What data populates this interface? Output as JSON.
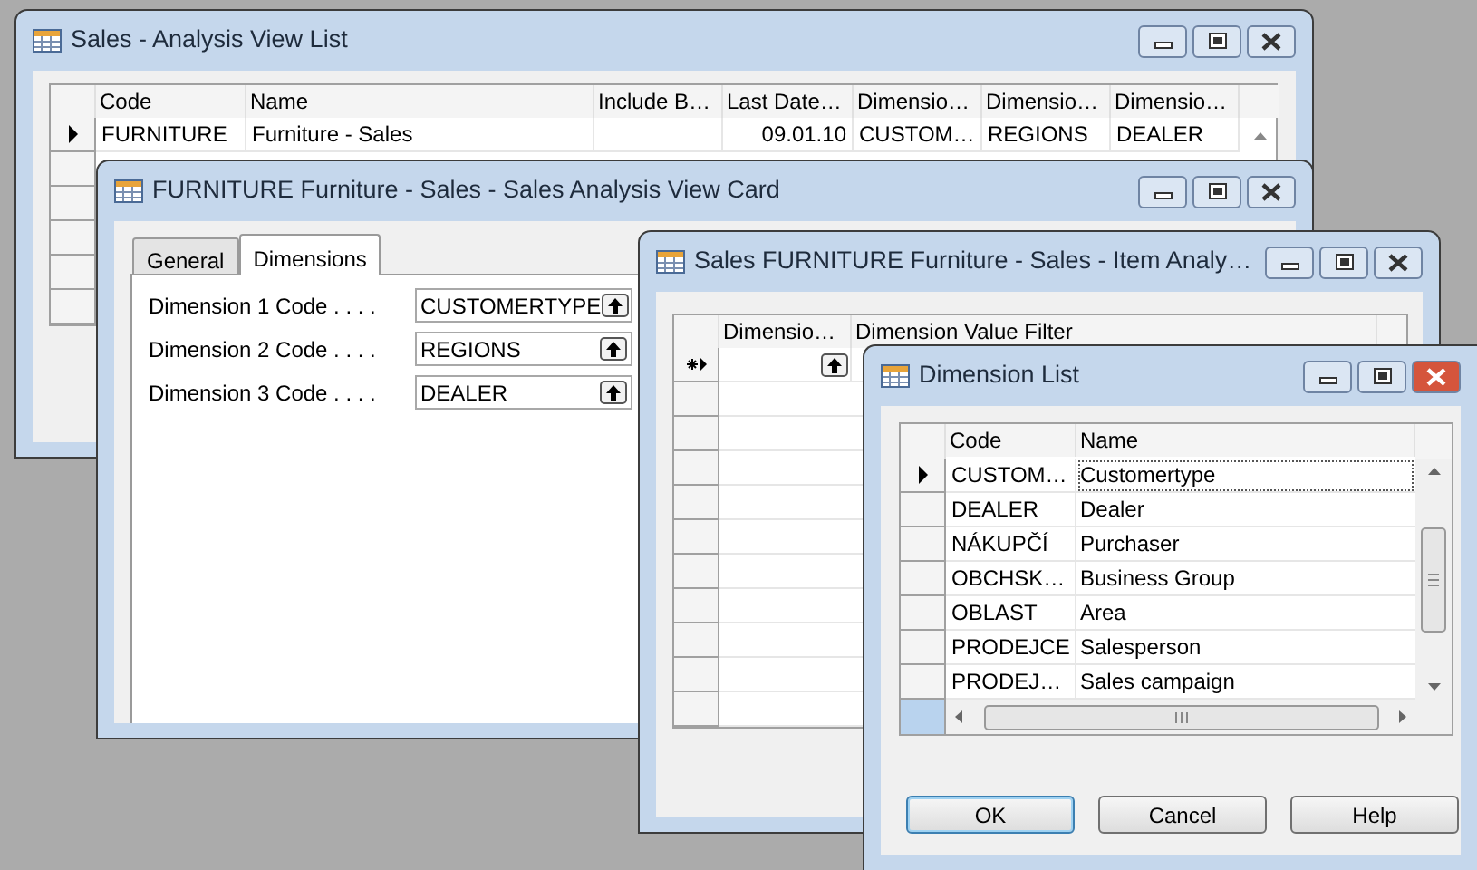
{
  "analysis_view_list": {
    "title": "Sales - Analysis View List",
    "columns": [
      "Code",
      "Name",
      "Include B…",
      "Last Date…",
      "Dimensio…",
      "Dimensio…",
      "Dimensio…"
    ],
    "rows": [
      {
        "selected": true,
        "cells": [
          "FURNITURE",
          "Furniture - Sales",
          "",
          "09.01.10",
          "CUSTOM…",
          "REGIONS",
          "DEALER"
        ]
      }
    ]
  },
  "view_card": {
    "title": "FURNITURE Furniture - Sales - Sales Analysis View Card",
    "tabs": [
      {
        "label": "General",
        "selected": false
      },
      {
        "label": "Dimensions",
        "selected": true
      }
    ],
    "fields": [
      {
        "label": "Dimension 1 Code . . . .",
        "value": "CUSTOMERTYPE"
      },
      {
        "label": "Dimension 2 Code . . . .",
        "value": "REGIONS"
      },
      {
        "label": "Dimension 3 Code . . . .",
        "value": "DEALER"
      }
    ]
  },
  "item_analysis": {
    "title": "Sales FURNITURE Furniture - Sales - Item Analy…",
    "columns": [
      "Dimensio…",
      "Dimension Value Filter"
    ]
  },
  "dimension_list": {
    "title": "Dimension List",
    "columns": [
      "Code",
      "Name"
    ],
    "rows": [
      {
        "code": "CUSTOM…",
        "name": "Customertype",
        "selected": true
      },
      {
        "code": "DEALER",
        "name": "Dealer",
        "selected": false
      },
      {
        "code": "NÁKUPČÍ",
        "name": "Purchaser",
        "selected": false
      },
      {
        "code": "OBCHSK…",
        "name": "Business Group",
        "selected": false
      },
      {
        "code": "OBLAST",
        "name": "Area",
        "selected": false
      },
      {
        "code": "PRODEJCE",
        "name": "Salesperson",
        "selected": false
      },
      {
        "code": "PRODEJ…",
        "name": "Sales campaign",
        "selected": false
      }
    ],
    "buttons": [
      "OK",
      "Cancel",
      "Help"
    ]
  }
}
